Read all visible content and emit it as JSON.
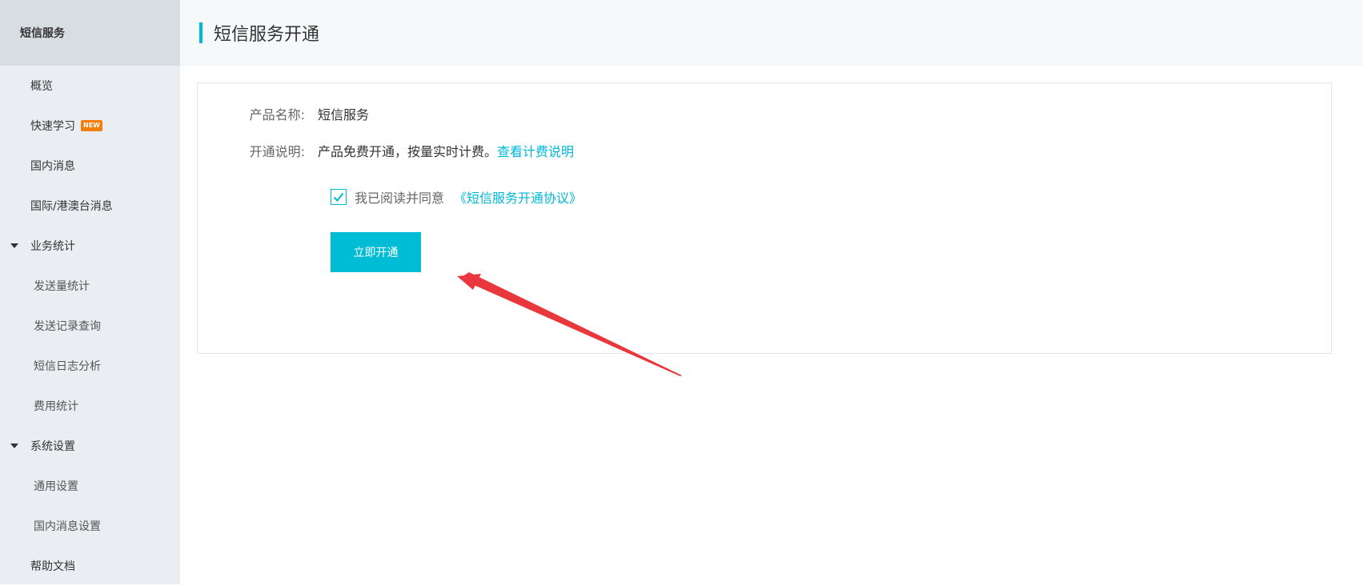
{
  "sidebar": {
    "title": "短信服务",
    "items": [
      {
        "label": "概览",
        "type": "item"
      },
      {
        "label": "快速学习",
        "type": "item",
        "badge": "NEW"
      },
      {
        "label": "国内消息",
        "type": "item"
      },
      {
        "label": "国际/港澳台消息",
        "type": "item"
      },
      {
        "label": "业务统计",
        "type": "group"
      },
      {
        "label": "发送量统计",
        "type": "sub"
      },
      {
        "label": "发送记录查询",
        "type": "sub"
      },
      {
        "label": "短信日志分析",
        "type": "sub"
      },
      {
        "label": "费用统计",
        "type": "sub"
      },
      {
        "label": "系统设置",
        "type": "group"
      },
      {
        "label": "通用设置",
        "type": "sub"
      },
      {
        "label": "国内消息设置",
        "type": "sub"
      },
      {
        "label": "帮助文档",
        "type": "item"
      }
    ]
  },
  "header": {
    "title": "短信服务开通"
  },
  "form": {
    "product_label": "产品名称:",
    "product_value": "短信服务",
    "desc_label": "开通说明:",
    "desc_value": "产品免费开通，按量实时计费。",
    "desc_link": "查看计费说明",
    "agree_text": "我已阅读并同意",
    "agree_link": "《短信服务开通协议》",
    "agree_checked": true,
    "submit_label": "立即开通"
  },
  "colors": {
    "accent": "#00b8d9",
    "button": "#00bcd4",
    "annotation_arrow": "#e8383d"
  }
}
